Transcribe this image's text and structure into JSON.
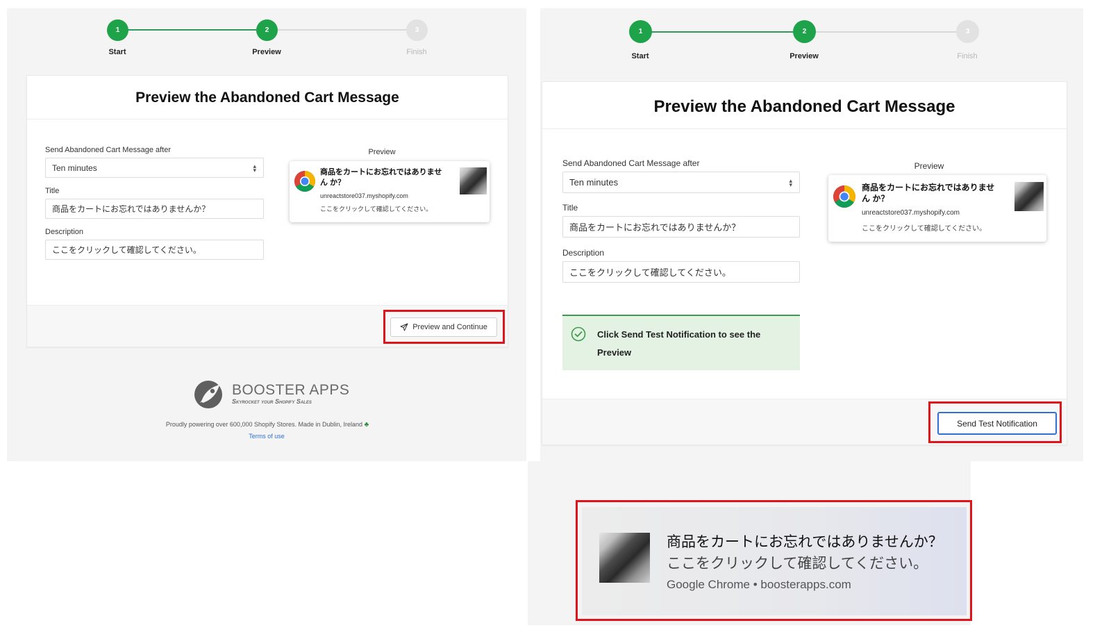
{
  "left": {
    "steps": [
      {
        "number": "1",
        "label": "Start"
      },
      {
        "number": "2",
        "label": "Preview"
      },
      {
        "number": "3",
        "label": "Finish"
      }
    ],
    "card": {
      "title": "Preview the Abandoned Cart Message",
      "send_after_label": "Send Abandoned Cart Message after",
      "send_after_value": "Ten minutes",
      "title_label": "Title",
      "title_value": "商品をカートにお忘れではありませんか？",
      "description_label": "Description",
      "description_value": "ここをクリックして確認してください。",
      "preview_label": "Preview",
      "notification": {
        "title": "商品をカートにお忘れではありません か？",
        "site": "unreactstore037.myshopify.com",
        "desc": "ここをクリックして確認してください。"
      },
      "button_label": "Preview and Continue"
    },
    "branding": {
      "logo_text": "BOOSTER APPS",
      "tagline": "Skyrocket your Shopify Sales",
      "powered": "Proudly powering over 600,000 Shopify Stores. Made in Dublin, Ireland",
      "terms": "Terms of use"
    }
  },
  "right": {
    "steps": [
      {
        "number": "1",
        "label": "Start"
      },
      {
        "number": "2",
        "label": "Preview"
      },
      {
        "number": "3",
        "label": "Finish"
      }
    ],
    "card": {
      "title": "Preview the Abandoned Cart Message",
      "send_after_label": "Send Abandoned Cart Message after",
      "send_after_value": "Ten minutes",
      "title_label": "Title",
      "title_value": "商品をカートにお忘れではありませんか？",
      "description_label": "Description",
      "description_value": "ここをクリックして確認してください。",
      "preview_label": "Preview",
      "notification": {
        "title": "商品をカートにお忘れではありません か？",
        "site": "unreactstore037.myshopify.com",
        "desc": "ここをクリックして確認してください。"
      },
      "success_message": "Click Send Test Notification to see the Preview",
      "button_label": "Send Test Notification"
    }
  },
  "system_notification": {
    "title": "商品をカートにお忘れではありませんか？",
    "desc": "ここをクリックして確認してください。",
    "source": "Google Chrome • boosterapps.com"
  },
  "colors": {
    "accent_green": "#1fa34a",
    "highlight_red": "#e1141c",
    "button_blue": "#2f6fd8"
  }
}
